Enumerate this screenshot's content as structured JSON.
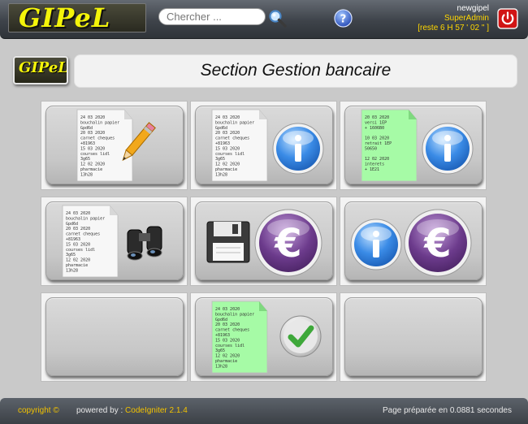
{
  "header": {
    "logo_text": "GIPeL",
    "search_placeholder": "Chercher ...",
    "user": {
      "name": "newgipel",
      "role": "SuperAdmin",
      "session": "[reste 6 H 57 ' 02 \" ]"
    },
    "icons": {
      "search": "magnifier-icon",
      "help": "help-question-icon",
      "logout": "power-icon"
    }
  },
  "page": {
    "small_logo_text": "GIPeL",
    "title": "Section Gestion bancaire"
  },
  "tiles": [
    {
      "id": "edit-entries",
      "icons": [
        "document-list-icon",
        "pencil-icon"
      ]
    },
    {
      "id": "info-entries",
      "icons": [
        "document-list-icon",
        "info-icon"
      ]
    },
    {
      "id": "info-statements",
      "icons": [
        "green-statement-icon",
        "info-icon"
      ]
    },
    {
      "id": "search-entries",
      "icons": [
        "document-list-icon",
        "binoculars-icon"
      ]
    },
    {
      "id": "save-money",
      "icons": [
        "floppy-disk-icon",
        "euro-icon"
      ]
    },
    {
      "id": "info-money",
      "icons": [
        "info-icon",
        "euro-icon"
      ]
    },
    {
      "id": "empty-1",
      "icons": []
    },
    {
      "id": "validate-entries",
      "icons": [
        "green-document-list-icon",
        "check-icon"
      ]
    },
    {
      "id": "empty-2",
      "icons": []
    }
  ],
  "doc_lines": [
    "24 03 2020",
    "bouchalin papier",
    "   Gpd6d",
    "20 03 2020",
    "carnet cheques",
    "+81963",
    "15 03 2020",
    "courses lidl",
    "   3g65",
    "12 02 2020",
    "pharmacie",
    "   13h28"
  ],
  "statement_lines": [
    "20 03 2020",
    "versi 1EP",
    "+ 1606B0",
    "",
    "10 03 2020",
    "retrait 1EP",
    "  50650",
    "",
    "12 02 2020",
    "interets",
    "+  1E21"
  ],
  "footer": {
    "copyright": "copyright ©",
    "powered_prefix": "powered by : ",
    "powered_link": "CodeIgniter 2.1.4",
    "render_time": "Page préparée en 0.0881 secondes"
  },
  "colors": {
    "header_bg": "#3e434a",
    "logo_yellow": "#f4f40a",
    "user_role": "#ffd700",
    "footer_link": "#f2c200",
    "euro_purple": "#6c3b8c",
    "info_blue": "#2b79d9",
    "check_green": "#3ea83a",
    "statement_green": "#9dfb9d"
  }
}
